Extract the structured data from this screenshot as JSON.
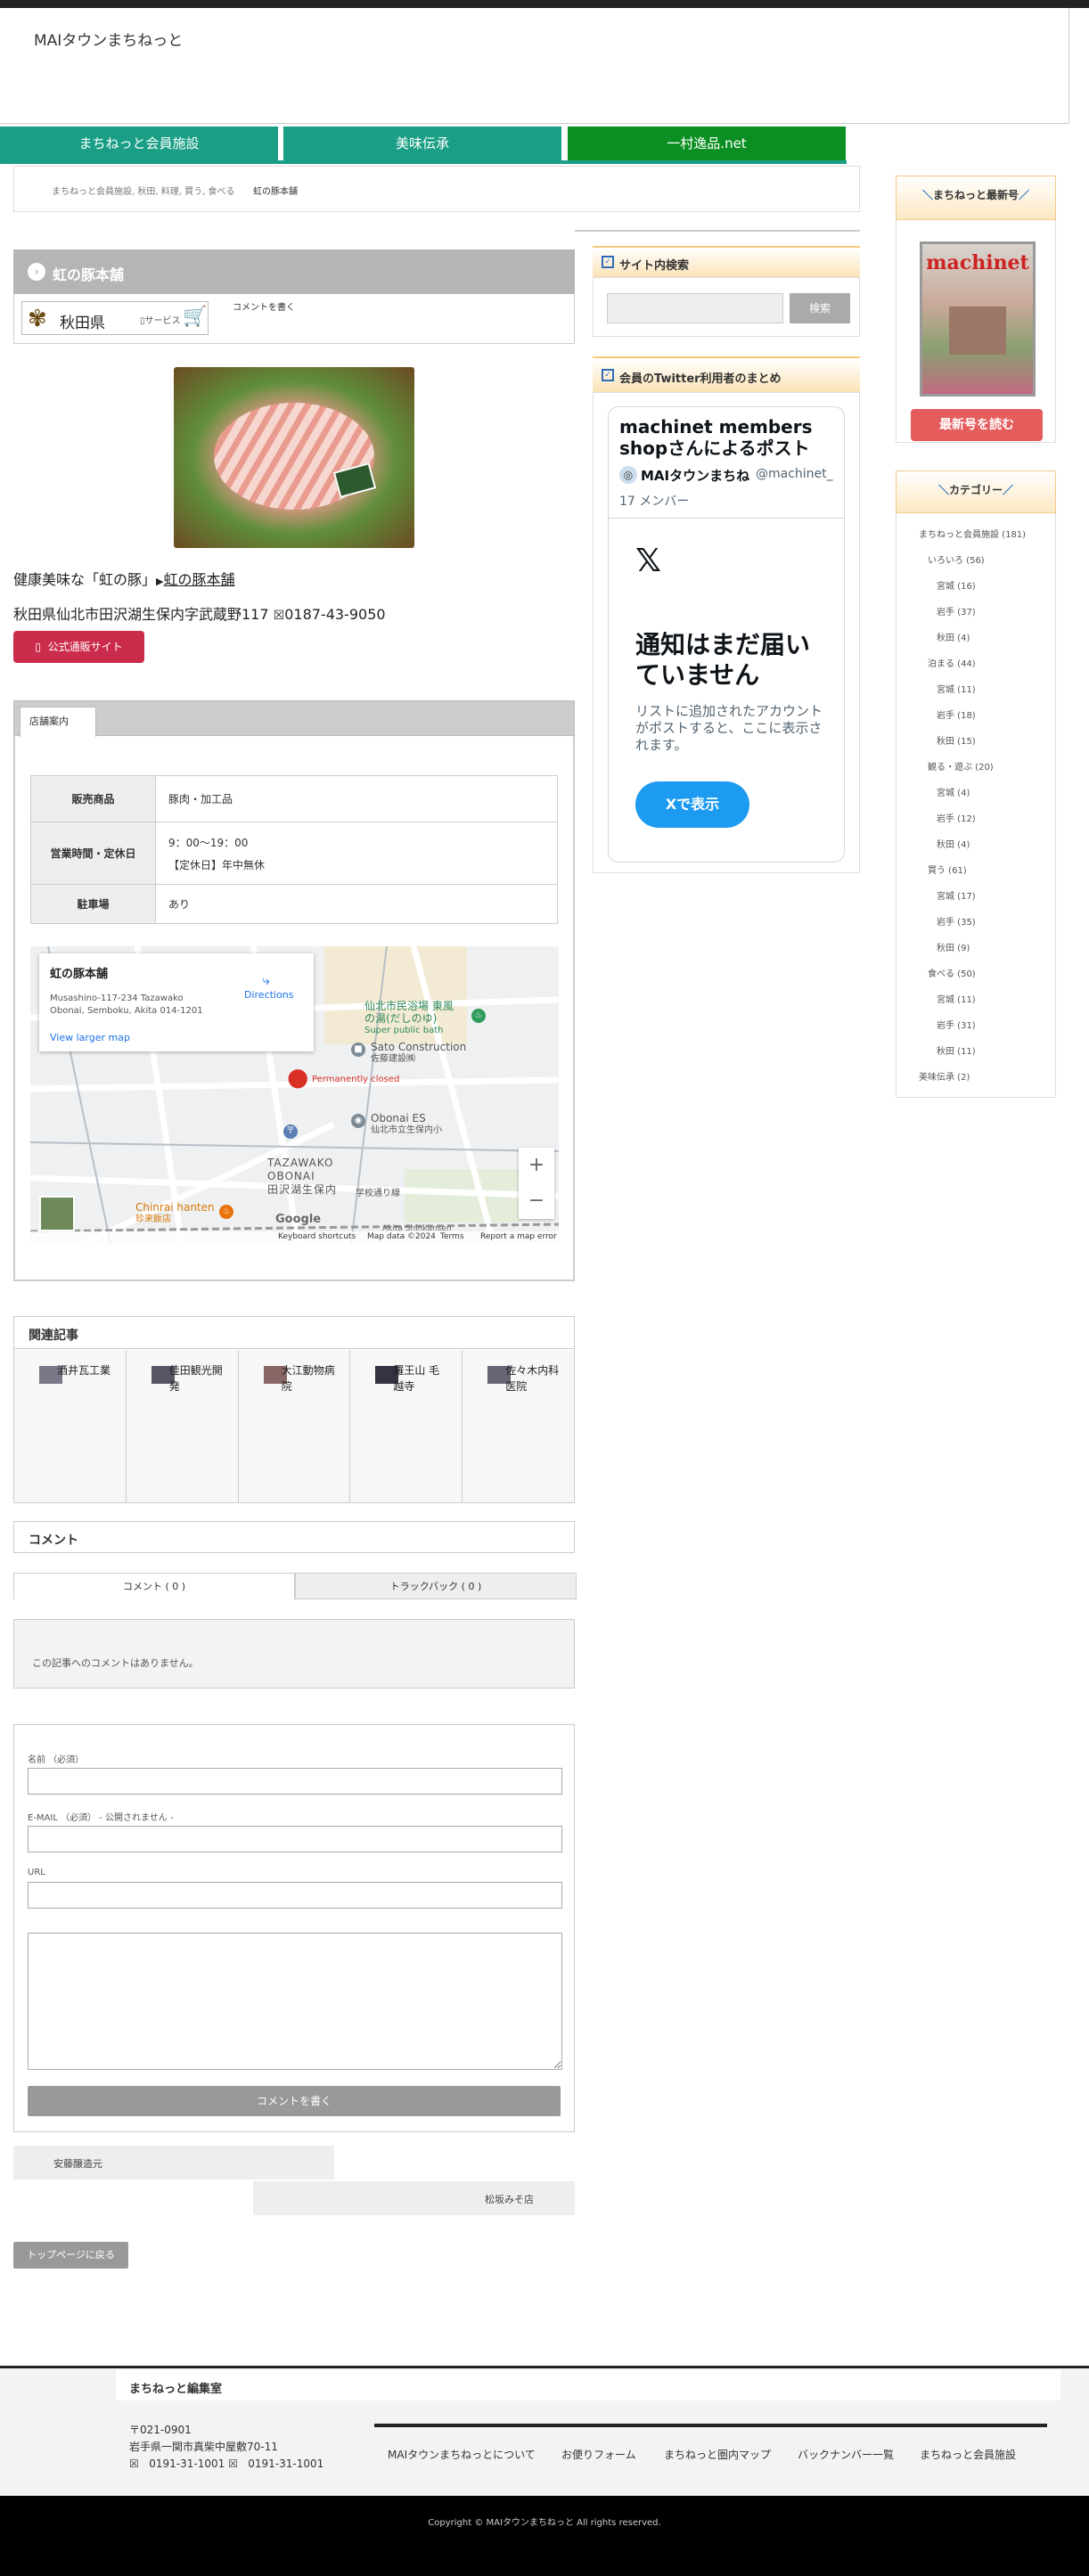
{
  "site": {
    "title": "MAIタウンまちねっと"
  },
  "gnav": [
    "まちねっと会員施設",
    "美味伝承",
    "一村逸品.net"
  ],
  "breadcrumb": {
    "path": "まちねっと会員施設, 秋田, 料理, 買う, 食べる",
    "current": "虹の豚本舗"
  },
  "article": {
    "title": "虹の豚本舗",
    "pref": "秋田県",
    "service_label": "サービス",
    "comment_link": "コメントを書く",
    "desc_prefix": "健康美味な「虹の豚」",
    "desc_link": "虹の豚本舗",
    "address": "秋田県仙北市田沢湖生保内字武蔵野117",
    "phone": "0187-43-9050",
    "shop_button": "公式通販サイト"
  },
  "shop_info": {
    "tab": "店舗案内",
    "rows": [
      {
        "label": "販売商品",
        "value": "豚肉・加工品"
      },
      {
        "label": "営業時間・定休日",
        "value": "9：00〜19：00",
        "value2": "【定休日】年中無休"
      },
      {
        "label": "駐車場",
        "value": "あり"
      }
    ]
  },
  "map": {
    "place": "虹の豚本舗",
    "addr1": "Musashino-117-234 Tazawako",
    "addr2": "Obonai, Semboku, Akita 014-1201",
    "directions": "Directions",
    "larger": "View larger map",
    "closed": "Permanently closed",
    "bath": "仙北市民浴場 東風",
    "bath2": "の湯(だしのゆ)",
    "bath3": "Super public bath",
    "sato": "Sato Construction",
    "sato2": "佐藤建設㈱",
    "obonai_es": "Obonai ES",
    "obonai_es2": "仙北市立生保内小",
    "tazawako": "TAZAWAKO",
    "obonai": "OBONAI",
    "tazawako_jp": "田沢湖生保内",
    "chinrai": "Chinrai hanten",
    "chinrai2": "珍来飯店",
    "google": "Google",
    "keyboard": "Keyboard shortcuts",
    "mapdata": "Map data ©2024",
    "terms": "Terms",
    "report": "Report a map error",
    "shinkansen": "Akita Shinkansen",
    "school_rd": "学校通り線"
  },
  "related": {
    "title": "関連記事",
    "items": [
      "酒井瓦工業",
      "佳田観光開発",
      "大江動物病院",
      "羅王山 毛越寺",
      "佐々木内科医院"
    ]
  },
  "comments": {
    "title": "コメント",
    "tab_comment": "コメント ( 0 )",
    "tab_trackback": "トラックバック ( 0 )",
    "empty": "この記事へのコメントはありません。",
    "name_label": "名前 （必須）",
    "email_label": "E-MAIL （必須） - 公開されません -",
    "url_label": "URL",
    "submit": "コメントを書く"
  },
  "pager": {
    "prev": "安藤醸造元",
    "next": "松坂みそ店"
  },
  "back_top": "トップページに戻る",
  "sidebar": {
    "search_title": "サイト内検索",
    "search_button": "検索",
    "twitter_title": "会員のTwitter利用者のまとめ",
    "tw_list_title": "machinet members shopさんによるポスト",
    "tw_user": "MAIタウンまちね",
    "tw_handle": "@machinet_",
    "tw_members": "17 メンバー",
    "tw_empty_title": "通知はまだ届いていません",
    "tw_empty_desc": "リストに追加されたアカウントがポストすると、ここに表示されます。",
    "tw_button": "Xで表示"
  },
  "right": {
    "latest_title": "まちねっと最新号",
    "mag_name": "machinet",
    "read_button": "最新号を読む",
    "category_title": "カテゴリー",
    "categories": [
      {
        "label": "まちねっと会員施設 (181)",
        "level": 0
      },
      {
        "label": "いろいろ (56)",
        "level": 1
      },
      {
        "label": "宮城 (16)",
        "level": 2
      },
      {
        "label": "岩手 (37)",
        "level": 2
      },
      {
        "label": "秋田 (4)",
        "level": 2
      },
      {
        "label": "泊まる (44)",
        "level": 1
      },
      {
        "label": "宮城 (11)",
        "level": 2
      },
      {
        "label": "岩手 (18)",
        "level": 2
      },
      {
        "label": "秋田 (15)",
        "level": 2
      },
      {
        "label": "観る・遊ぶ (20)",
        "level": 1
      },
      {
        "label": "宮城 (4)",
        "level": 2
      },
      {
        "label": "岩手 (12)",
        "level": 2
      },
      {
        "label": "秋田 (4)",
        "level": 2
      },
      {
        "label": "買う (61)",
        "level": 1
      },
      {
        "label": "宮城 (17)",
        "level": 2
      },
      {
        "label": "岩手 (35)",
        "level": 2
      },
      {
        "label": "秋田 (9)",
        "level": 2
      },
      {
        "label": "食べる (50)",
        "level": 1
      },
      {
        "label": "宮城 (11)",
        "level": 2
      },
      {
        "label": "岩手 (31)",
        "level": 2
      },
      {
        "label": "秋田 (11)",
        "level": 2
      },
      {
        "label": "美味伝承 (2)",
        "level": 0
      }
    ]
  },
  "footer": {
    "editor_title": "まちねっと編集室",
    "zip": "〒021-0901",
    "address": "岩手県一関市真柴中屋敷70-11",
    "tel": "0191-31-1001",
    "fax": "0191-31-1001",
    "links": [
      "MAIタウンまちねっとについて",
      "お便りフォーム",
      "まちねっと圏内マップ",
      "バックナンバー一覧",
      "まちねっと会員施設"
    ],
    "copyright": "Copyright © MAIタウンまちねっと All rights reserved."
  }
}
